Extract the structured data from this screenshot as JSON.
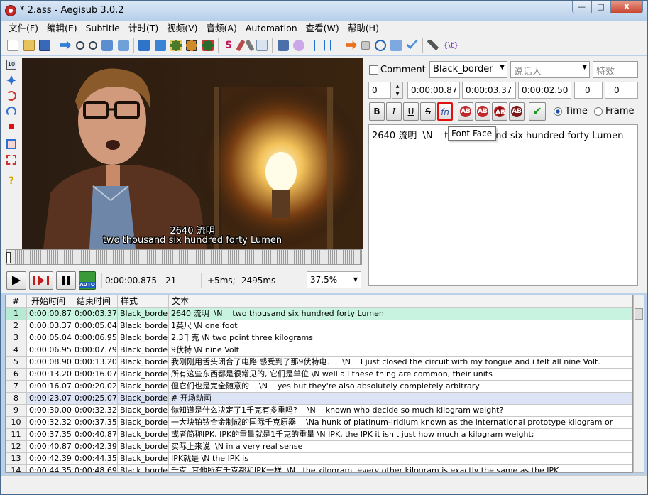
{
  "window": {
    "title": "* 2.ass - Aegisub 3.0.2",
    "min": "—",
    "max": "□",
    "close": "X"
  },
  "menu": [
    "文件(F)",
    "编辑(E)",
    "Subtitle",
    "计时(T)",
    "视频(V)",
    "音频(A)",
    "Automation",
    "查看(W)",
    "帮助(H)"
  ],
  "video": {
    "sub_line1": "2640 流明",
    "sub_line2": "two thousand six hundred forty Lumen",
    "time": "0:00:00.875 - 21",
    "offset": "+5ms; -2495ms",
    "zoom": "37.5%",
    "auto_label": "AUTO",
    "vt_top_label": "10"
  },
  "edit": {
    "comment_label": "Comment",
    "style": "Black_border",
    "actor_placeholder": "说话人",
    "effect_placeholder": "特效",
    "layer": "0",
    "start": "0:00:00.87",
    "end": "0:00:03.37",
    "duration": "0:00:02.50",
    "margin_l": "0",
    "margin_r": "0",
    "bold": "B",
    "italic": "I",
    "underline": "U",
    "strike": "S",
    "font_face": "fn",
    "ab": "AB",
    "commit": "✔",
    "time_label": "Time",
    "frame_label": "Frame",
    "text": "2640 流明  \\N    two thousand six hundred forty Lumen",
    "tooltip": "Font Face"
  },
  "grid": {
    "headers": [
      "#",
      "开始时间",
      "结束时间",
      "样式",
      "文本"
    ],
    "rows": [
      {
        "n": "1",
        "start": "0:00:00.87",
        "end": "0:00:03.37",
        "style": "Black_border",
        "text": "2640 流明  \\N    two thousand six hundred forty Lumen"
      },
      {
        "n": "2",
        "start": "0:00:03.37",
        "end": "0:00:05.04",
        "style": "Black_border",
        "text": "1英尺 \\N one foot"
      },
      {
        "n": "3",
        "start": "0:00:05.04",
        "end": "0:00:06.95",
        "style": "Black_border",
        "text": "2.3千克 \\N two point three kilograms"
      },
      {
        "n": "4",
        "start": "0:00:06.95",
        "end": "0:00:07.79",
        "style": "Black_border",
        "text": "9伏特 \\N nine Volt"
      },
      {
        "n": "5",
        "start": "0:00:08.90",
        "end": "0:00:13.20",
        "style": "Black_border",
        "text": "我刚刚用舌头闭合了电路 感受到了那9伏特电．   \\N    I just closed the circuit with my tongue and i felt all nine Volt."
      },
      {
        "n": "6",
        "start": "0:00:13.20",
        "end": "0:00:16.07",
        "style": "Black_border",
        "text": "所有这些东西都是很常见的, 它们是单位 \\N well all these thing are common, their units"
      },
      {
        "n": "7",
        "start": "0:00:16.07",
        "end": "0:00:20.02",
        "style": "Black_border",
        "text": "但它们也是完全随意的    \\N    yes but they're also absolutely completely arbitrary"
      },
      {
        "n": "8",
        "start": "0:00:23.07",
        "end": "0:00:25.07",
        "style": "Black_border",
        "text": "# 开场动画"
      },
      {
        "n": "9",
        "start": "0:00:30.00",
        "end": "0:00:32.32",
        "style": "Black_border",
        "text": "你知道是什么决定了1千克有多重吗?    \\N    known who decide so much kilogram weight?"
      },
      {
        "n": "10",
        "start": "0:00:32.32",
        "end": "0:00:37.35",
        "style": "Black_border",
        "text": "一大块铂铱合金制成的国际千克原器    \\Na hunk of platinum-iridium known as the international prototype kilogram or"
      },
      {
        "n": "11",
        "start": "0:00:37.35",
        "end": "0:00:40.87",
        "style": "Black_border",
        "text": "或者简称IPK, IPK的重量就是1千克的重量 \\N IPK, the IPK it isn't just how much a kilogram weight;"
      },
      {
        "n": "12",
        "start": "0:00:40.87",
        "end": "0:00:42.39",
        "style": "Black_border",
        "text": "实际上来说  \\N in a very real sense"
      },
      {
        "n": "13",
        "start": "0:00:42.39",
        "end": "0:00:44.35",
        "style": "Black_border",
        "text": "IPK就是 \\N the IPK is"
      },
      {
        "n": "14",
        "start": "0:00:44.35",
        "end": "0:00:48.69",
        "style": "Black_border",
        "text": "千克, 其他所有千克都和IPK一样  \\N   the kilogram, every other kilogram is exactly the same as the IPK"
      }
    ]
  }
}
